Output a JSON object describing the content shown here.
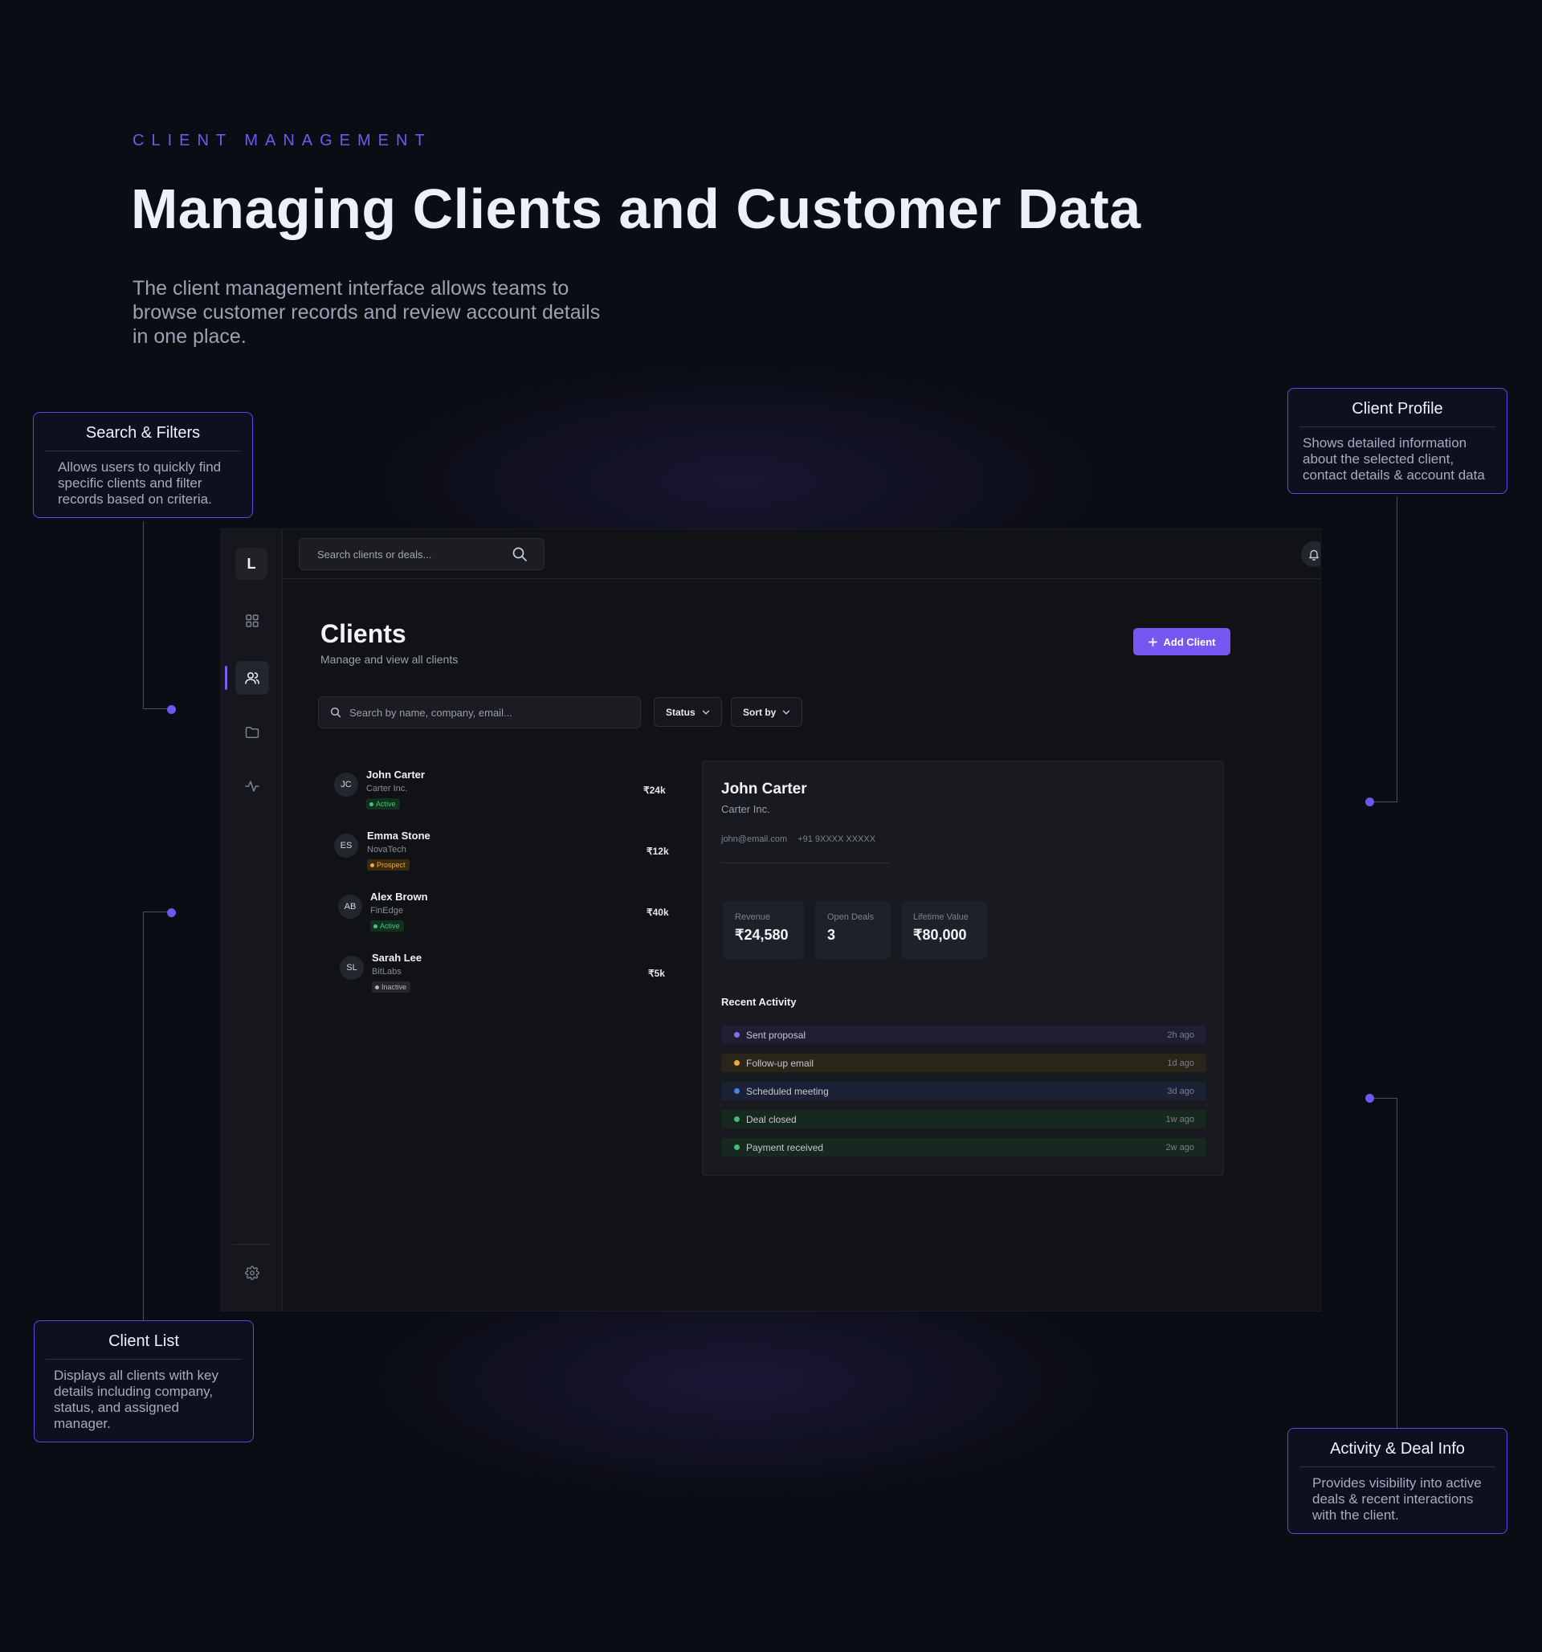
{
  "header": {
    "eyebrow": "CLIENT MANAGEMENT",
    "title": "Managing Clients and Customer Data",
    "description": "The client management interface allows teams to browse customer records and review account details in one place."
  },
  "callouts": {
    "search_filters": {
      "title": "Search & Filters",
      "body": "Allows users to quickly find specific clients and filter records based on criteria."
    },
    "client_profile": {
      "title": "Client Profile",
      "body": "Shows detailed information about the selected client, contact details & account data"
    },
    "client_list": {
      "title": "Client List",
      "body": "Displays all clients with key details including company, status, and assigned manager."
    },
    "activity_deal": {
      "title": "Activity & Deal Info",
      "body": "Provides visibility into active deals & recent interactions with the client."
    }
  },
  "app": {
    "logo": "L",
    "sidebar_icons": [
      "dashboard-icon",
      "users-icon",
      "folder-icon",
      "activity-icon",
      "settings-icon"
    ],
    "active_nav": "users-icon",
    "top_search_placeholder": "Search clients or deals...",
    "page_title": "Clients",
    "page_subtitle": "Manage and view all clients",
    "add_button": "Add Client",
    "filter_search_placeholder": "Search by name, company, email...",
    "status_dropdown": "Status",
    "sort_dropdown": "Sort by",
    "clients": [
      {
        "initials": "JC",
        "name": "John Carter",
        "company": "Carter Inc.",
        "status": "Active",
        "value": "₹24k"
      },
      {
        "initials": "ES",
        "name": "Emma Stone",
        "company": "NovaTech",
        "status": "Prospect",
        "value": "₹12k"
      },
      {
        "initials": "AB",
        "name": "Alex Brown",
        "company": "FinEdge",
        "status": "Active",
        "value": "₹40k"
      },
      {
        "initials": "SL",
        "name": "Sarah Lee",
        "company": "BitLabs",
        "status": "Inactive",
        "value": "₹5k"
      }
    ],
    "profile": {
      "name": "John Carter",
      "company": "Carter Inc.",
      "email": "john@email.com",
      "phone": "+91 9XXXX XXXXX",
      "stats": [
        {
          "label": "Revenue",
          "value": "₹24,580"
        },
        {
          "label": "Open Deals",
          "value": "3"
        },
        {
          "label": "Lifetime Value",
          "value": "₹80,000"
        }
      ],
      "activity_title": "Recent Activity",
      "activities": [
        {
          "label": "Sent proposal",
          "time": "2h ago",
          "color": "#8b6cf6",
          "bg": "#1f1e33"
        },
        {
          "label": "Follow-up email",
          "time": "1d ago",
          "color": "#f0a93b",
          "bg": "#2a2519"
        },
        {
          "label": "Scheduled meeting",
          "time": "3d ago",
          "color": "#4d7ff0",
          "bg": "#1b2236"
        },
        {
          "label": "Deal closed",
          "time": "1w ago",
          "color": "#3fbf73",
          "bg": "#172820"
        },
        {
          "label": "Payment received",
          "time": "2w ago",
          "color": "#3fbf73",
          "bg": "#172820"
        }
      ]
    }
  }
}
